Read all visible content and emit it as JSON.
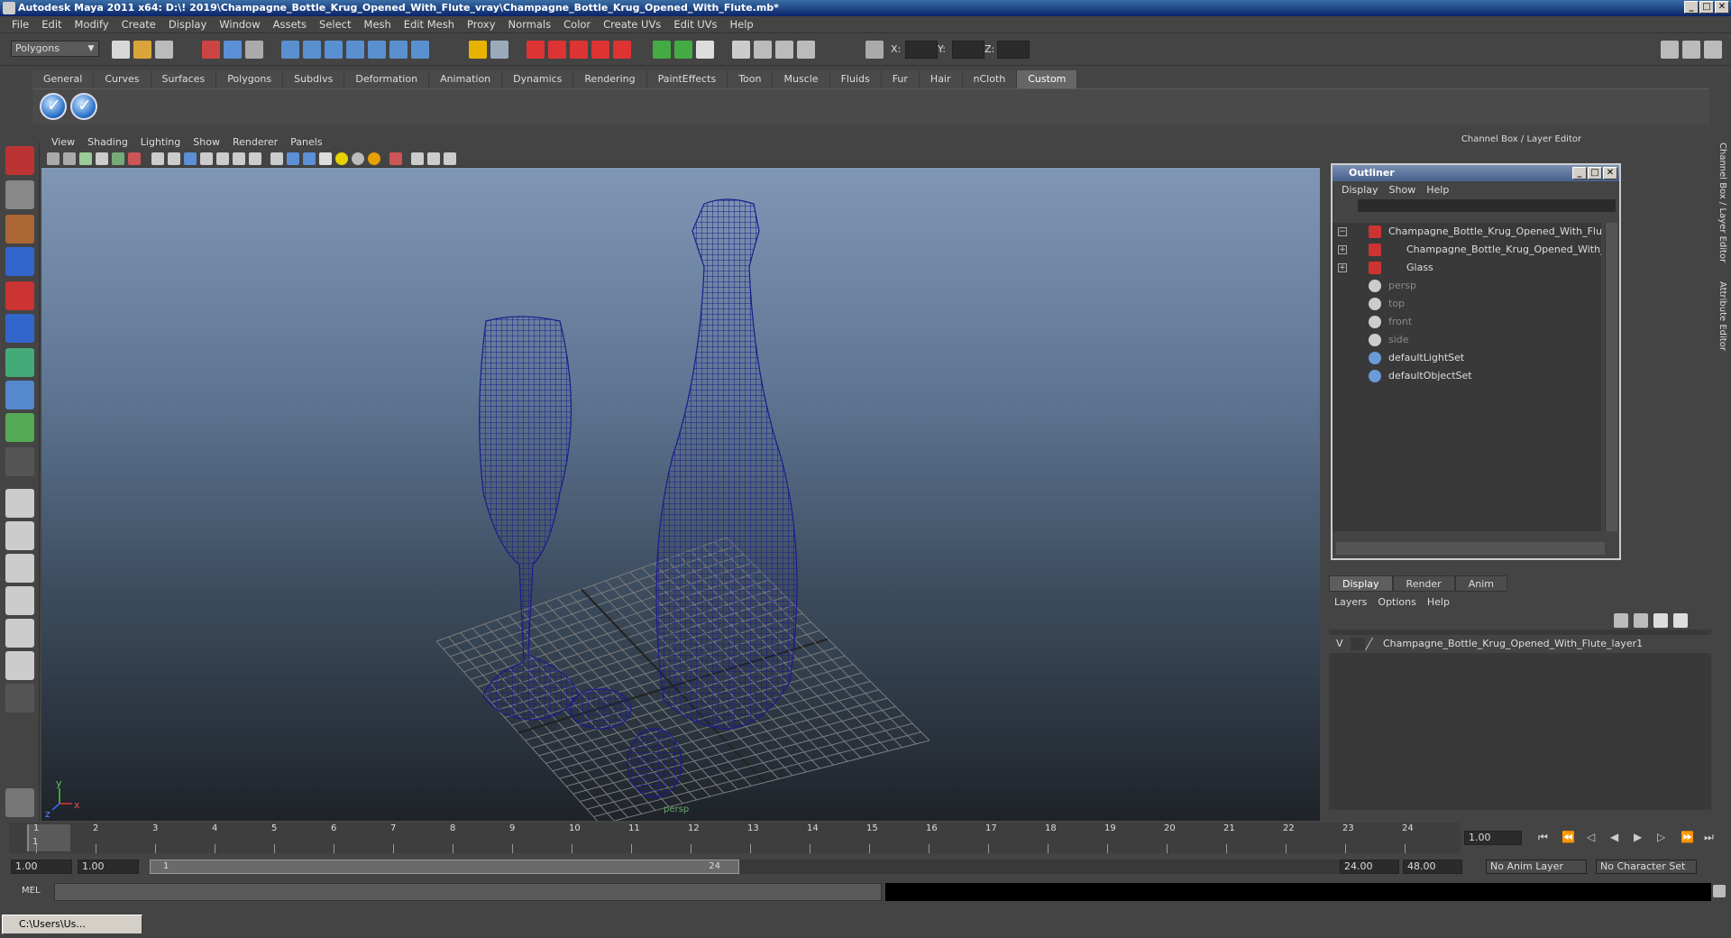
{
  "window": {
    "title": "Autodesk Maya 2011 x64: D:\\! 2019\\Champagne_Bottle_Krug_Opened_With_Flute_vray\\Champagne_Bottle_Krug_Opened_With_Flute.mb*",
    "minimize": "_",
    "maximize": "□",
    "close": "✕"
  },
  "menubar": [
    "File",
    "Edit",
    "Modify",
    "Create",
    "Display",
    "Window",
    "Assets",
    "Select",
    "Mesh",
    "Edit Mesh",
    "Proxy",
    "Normals",
    "Color",
    "Create UVs",
    "Edit UVs",
    "Help"
  ],
  "statusline": {
    "mode": "Polygons",
    "x_label": "X:",
    "y_label": "Y:",
    "z_label": "Z:"
  },
  "shelf": {
    "tabs": [
      "General",
      "Curves",
      "Surfaces",
      "Polygons",
      "Subdivs",
      "Deformation",
      "Animation",
      "Dynamics",
      "Rendering",
      "PaintEffects",
      "Toon",
      "Muscle",
      "Fluids",
      "Fur",
      "Hair",
      "nCloth",
      "Custom"
    ],
    "active_tab": "Custom"
  },
  "viewport": {
    "menu": [
      "View",
      "Shading",
      "Lighting",
      "Show",
      "Renderer",
      "Panels"
    ],
    "camera_label": "persp",
    "axis_y": "y",
    "axis_x": "x",
    "axis_z": "z",
    "wire_color": "#1a1a8a"
  },
  "channel_box": {
    "title": "Channel Box / Layer Editor"
  },
  "outliner": {
    "title": "Outliner",
    "menu": [
      "Display",
      "Show",
      "Help"
    ],
    "items": [
      {
        "label": "Champagne_Bottle_Krug_Opened_With_Flute",
        "expander": "−",
        "indent": 0,
        "dim": false,
        "kind": "mesh"
      },
      {
        "label": "Champagne_Bottle_Krug_Opened_With_F",
        "expander": "+",
        "indent": 1,
        "dim": false,
        "kind": "mesh"
      },
      {
        "label": "Glass",
        "expander": "+",
        "indent": 1,
        "dim": false,
        "kind": "mesh"
      },
      {
        "label": "persp",
        "expander": "",
        "indent": 0,
        "dim": true,
        "kind": "camera"
      },
      {
        "label": "top",
        "expander": "",
        "indent": 0,
        "dim": true,
        "kind": "camera"
      },
      {
        "label": "front",
        "expander": "",
        "indent": 0,
        "dim": true,
        "kind": "camera"
      },
      {
        "label": "side",
        "expander": "",
        "indent": 0,
        "dim": true,
        "kind": "camera"
      },
      {
        "label": "defaultLightSet",
        "expander": "",
        "indent": 0,
        "dim": false,
        "kind": "set"
      },
      {
        "label": "defaultObjectSet",
        "expander": "",
        "indent": 0,
        "dim": false,
        "kind": "set"
      }
    ]
  },
  "layer_editor": {
    "tabs": [
      "Display",
      "Render",
      "Anim"
    ],
    "active_tab": "Display",
    "menu": [
      "Layers",
      "Options",
      "Help"
    ],
    "layers": [
      {
        "visible": "V",
        "name": "Champagne_Bottle_Krug_Opened_With_Flute_layer1"
      }
    ]
  },
  "side_tabs": [
    "Channel Box / Layer Editor",
    "Attribute Editor"
  ],
  "timeline": {
    "ticks": [
      "1",
      "2",
      "3",
      "4",
      "5",
      "6",
      "7",
      "8",
      "9",
      "10",
      "11",
      "12",
      "13",
      "14",
      "15",
      "16",
      "17",
      "18",
      "19",
      "20",
      "21",
      "22",
      "23",
      "24"
    ],
    "current_frame_label": "1",
    "current_time": "1.00"
  },
  "range": {
    "start_time": "1.00",
    "playback_start": "1.00",
    "slider_start": "1",
    "slider_end": "24",
    "playback_end": "24.00",
    "end_time": "48.00",
    "anim_layer": "No Anim Layer",
    "character_set": "No Character Set"
  },
  "command_line": {
    "label": "MEL"
  },
  "taskbar": {
    "item": "C:\\Users\\Us..."
  }
}
